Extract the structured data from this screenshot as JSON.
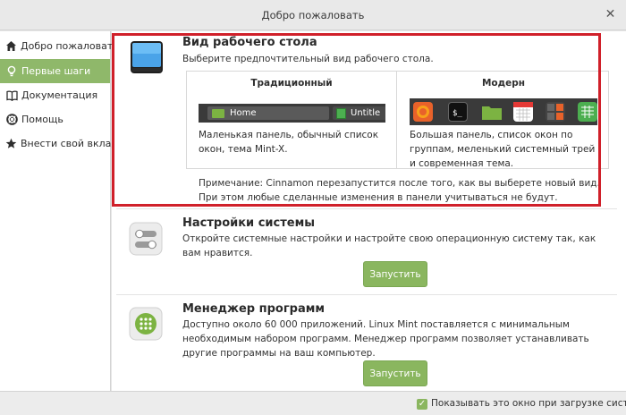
{
  "window": {
    "title": "Добро пожаловать"
  },
  "sidebar": {
    "items": [
      {
        "label": "Добро пожаловать",
        "icon": "home-icon",
        "active": false
      },
      {
        "label": "Первые шаги",
        "icon": "lightbulb-icon",
        "active": true
      },
      {
        "label": "Документация",
        "icon": "book-icon",
        "active": false
      },
      {
        "label": "Помощь",
        "icon": "lifebuoy-icon",
        "active": false
      },
      {
        "label": "Внести свой вклад",
        "icon": "star-icon",
        "active": false
      }
    ]
  },
  "desktop_layout": {
    "title": "Вид рабочего стола",
    "description": "Выберите предпочтительный вид рабочего стола.",
    "traditional": {
      "heading": "Традиционный",
      "panel_items": [
        "Home",
        "Untitle"
      ],
      "text": "Маленькая панель, обычный список окон, тема Mint-X."
    },
    "modern": {
      "heading": "Модерн",
      "text": "Большая панель, список окон по группам, меленький системный трей и современная тема."
    },
    "note": "Примечание: Cinnamon перезапустится после того, как вы выберете новый вид. При этом любые сделанные изменения в панели учитываться не будут."
  },
  "system_settings": {
    "title": "Настройки системы",
    "description": "Откройте системные настройки и настройте свою операционную систему так, как вам нравится.",
    "button": "Запустить"
  },
  "software_manager": {
    "title": "Менеджер программ",
    "description": "Доступно около 60 000 приложений. Linux Mint поставляется с минимальным необходимым набором программ. Менеджер программ позволяет устанавливать другие программы на ваш компьютер.",
    "button": "Запустить"
  },
  "footer": {
    "checkbox_label": "Показывать это окно при загрузке системы",
    "checked": true
  },
  "colors": {
    "accent": "#8ab65f",
    "highlight_border": "#d0202a"
  }
}
